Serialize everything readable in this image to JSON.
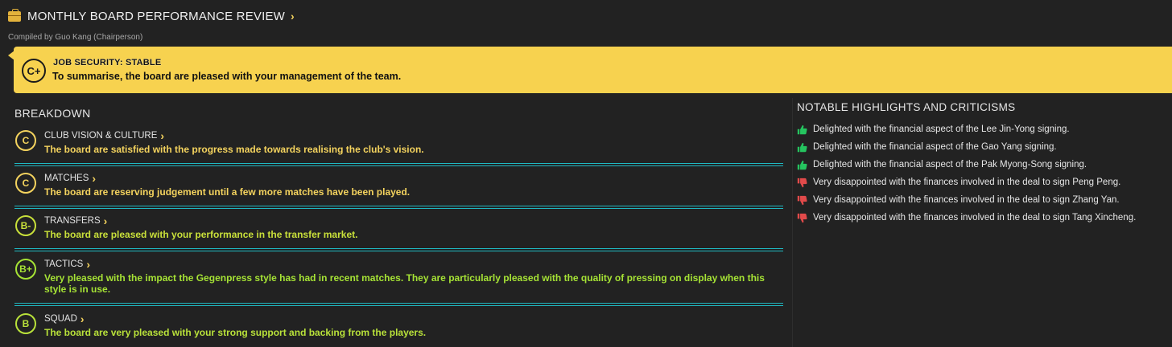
{
  "header": {
    "icon": "briefcase-icon",
    "title": "MONTHLY BOARD PERFORMANCE REVIEW",
    "subtitle": "Compiled by Guo Kang (Chairperson)"
  },
  "banner": {
    "grade": "C+",
    "status": "JOB SECURITY: STABLE",
    "summary": "To summarise, the board are pleased with your management of the team.",
    "color": "#f7d24f"
  },
  "breakdown": {
    "title": "BREAKDOWN",
    "items": [
      {
        "grade": "C",
        "name": "CLUB VISION & CULTURE",
        "desc": "The board are satisfied with the progress made towards realising the club's vision.",
        "color": "#f4d35e"
      },
      {
        "grade": "C",
        "name": "MATCHES",
        "desc": "The board are reserving judgement until a few more matches have been played.",
        "color": "#f4d35e"
      },
      {
        "grade": "B-",
        "name": "TRANSFERS",
        "desc": "The board are pleased with your performance in the transfer market.",
        "color": "#c9e03a"
      },
      {
        "grade": "B+",
        "name": "TACTICS",
        "desc": "Very pleased with the impact the Gegenpress style has had in recent matches. They are particularly pleased with the quality of pressing on display when this style is in use.",
        "color": "#a6e335"
      },
      {
        "grade": "B",
        "name": "SQUAD",
        "desc": "The board are very pleased with your strong support and backing from the players.",
        "color": "#b9e23a"
      }
    ]
  },
  "highlights": {
    "title": "NOTABLE HIGHLIGHTS AND CRITICISMS",
    "positive_color": "#25c45f",
    "negative_color": "#e24a4a",
    "items": [
      {
        "type": "positive",
        "icon": "thumbs-up-icon",
        "text": "Delighted with the financial aspect of the Lee Jin-Yong signing."
      },
      {
        "type": "positive",
        "icon": "thumbs-up-icon",
        "text": "Delighted with the financial aspect of the Gao Yang signing."
      },
      {
        "type": "positive",
        "icon": "thumbs-up-icon",
        "text": "Delighted with the financial aspect of the Pak Myong-Song signing."
      },
      {
        "type": "negative",
        "icon": "thumbs-down-icon",
        "text": "Very disappointed with the finances involved in the deal to sign Peng Peng."
      },
      {
        "type": "negative",
        "icon": "thumbs-down-icon",
        "text": "Very disappointed with the finances involved in the deal to sign Zhang Yan."
      },
      {
        "type": "negative",
        "icon": "thumbs-down-icon",
        "text": "Very disappointed with the finances involved in the deal to sign Tang Xincheng."
      }
    ]
  }
}
